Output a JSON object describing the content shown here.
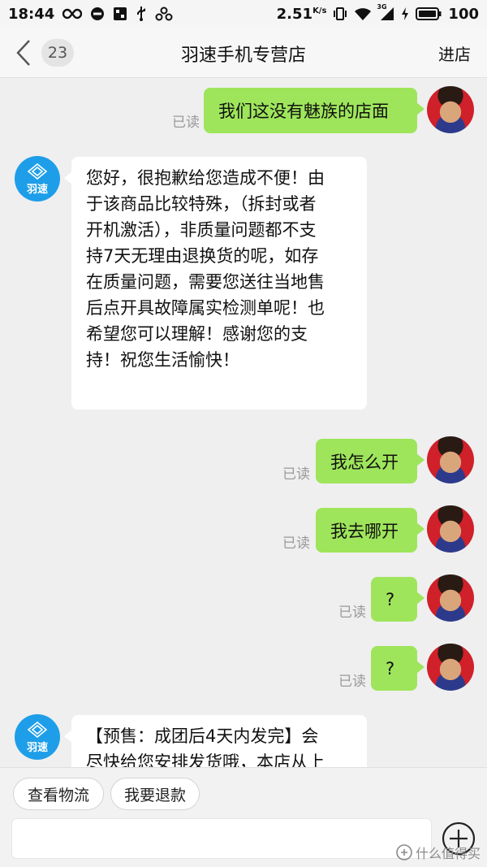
{
  "status_bar": {
    "time": "18:44",
    "speed": "2.51",
    "speed_unit": "K/s",
    "network": "3G",
    "battery": "100"
  },
  "header": {
    "unread_count": "23",
    "title": "羽速手机专营店",
    "enter_shop": "进店"
  },
  "shop": {
    "avatar_text": "羽速",
    "brand_color": "#1e9ee8"
  },
  "colors": {
    "outgoing_bubble": "#9ee55b",
    "incoming_bubble": "#ffffff",
    "background": "#efefef"
  },
  "messages": [
    {
      "from": "user",
      "text": "我们这没有魅族的店面",
      "status": "已读"
    },
    {
      "from": "shop",
      "lines": [
        "您好，很抱歉给您造成不便！由",
        "于该商品比较特殊，（拆封或者",
        "开机激活），非质量问题都不支",
        "持7天无理由退换货的呢，如存",
        "在质量问题，需要您送往当地售",
        "后点开具故障属实检测单呢！也",
        "希望您可以理解！感谢您的支",
        "持！祝您生活愉快！"
      ]
    },
    {
      "from": "user",
      "text": "我怎么开",
      "status": "已读"
    },
    {
      "from": "user",
      "text": "我去哪开",
      "status": "已读"
    },
    {
      "from": "user",
      "text": "?",
      "status": "已读"
    },
    {
      "from": "user",
      "text": "?",
      "status": "已读"
    },
    {
      "from": "shop",
      "lines": [
        "【预售：成团后4天内发完】会",
        "尽快给您安排发货哦，本店从上"
      ]
    }
  ],
  "quick_actions": [
    "查看物流",
    "我要退款"
  ],
  "input": {
    "placeholder": ""
  },
  "watermark": "什么值得买"
}
